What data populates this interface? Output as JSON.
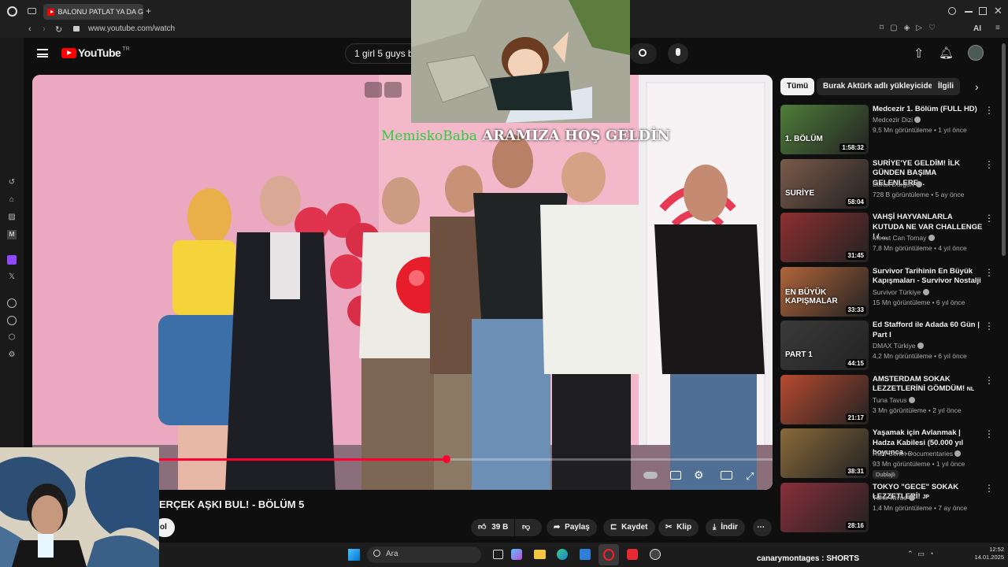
{
  "browser": {
    "tab_title": "BALONU PATLAT YA DA G",
    "address": "www.youtube.com/watch",
    "ai_label": "AI"
  },
  "youtube": {
    "logo": "YouTube",
    "region": "TR",
    "search_value": "1 girl 5 guys bli"
  },
  "overlay": {
    "ticker_name": "MemiskoBaba",
    "ticker_text": "ARAMIZA HOŞ GELDİN",
    "bottom_caption_user": "canarymontages",
    "bottom_caption_sep": ":",
    "bottom_caption_text": "SHORTS"
  },
  "video": {
    "title_visible": "ERÇEK AŞKI BUL! - BÖLÜM 5",
    "progress": 0.56,
    "sub_button_fragment": "ol"
  },
  "actions": {
    "like_count": "39 B",
    "share": "Paylaş",
    "save": "Kaydet",
    "clip": "Klip",
    "download": "İndir"
  },
  "chips": [
    "Tümü",
    "Burak Aktürk adlı yükleyiciden",
    "İlgili"
  ],
  "recommendations": [
    {
      "title": "Medcezir 1. Bölüm (FULL HD)",
      "channel": "Medcezir Dizi",
      "meta": "9,5 Mn görüntüleme • 1 yıl önce",
      "duration": "1:58:32",
      "thumb_text": "1. BÖLÜM",
      "color": "#4f7d3a"
    },
    {
      "title": "SURİYE'YE GELDİM! İLK GÜNDEN BAŞIMA GELENLERE...",
      "channel": "Burak Durgun",
      "meta": "728 B görüntüleme • 5 ay önce",
      "duration": "58:04",
      "thumb_text": "SURİYE",
      "color": "#7a5a4a"
    },
    {
      "title": "VAHŞİ HAYVANLARLA KUTUDA NE VAR CHALLENGE ! / ...",
      "channel": "Mesut Can Tomay",
      "meta": "7,8 Mn görüntüleme • 4 yıl önce",
      "duration": "31:45",
      "thumb_text": "",
      "color": "#8e2f2f"
    },
    {
      "title": "Survivor Tarihinin En Büyük Kapışmaları - Survivor Nostalji",
      "channel": "Survivor Türkiye",
      "meta": "15 Mn görüntüleme • 6 yıl önce",
      "duration": "33:33",
      "thumb_text": "EN BÜYÜK KAPIŞMALAR",
      "color": "#b0643a"
    },
    {
      "title": "Ed Stafford ile Adada 60 Gün | Part I",
      "channel": "DMAX Türkiye",
      "meta": "4,2 Mn görüntüleme • 6 yıl önce",
      "duration": "44:15",
      "thumb_text": "PART 1",
      "color": "#3a3a3a"
    },
    {
      "title": "AMSTERDAM SOKAK LEZZETLERİNİ GÖMDÜM!",
      "title_suffix": "NL",
      "channel": "Tuna Tavus",
      "meta": "3 Mn görüntüleme • 2 yıl önce",
      "duration": "21:17",
      "thumb_text": "",
      "color": "#b74a2f"
    },
    {
      "title": "Yaşamak için Avlanmak | Hadza Kabilesi (50.000 yıl boyunca ...",
      "channel": "Ruhi Cenet Documentaries",
      "meta": "93 Mn görüntüleme • 1 yıl önce",
      "duration": "38:31",
      "badge": "Dublajlı",
      "thumb_text": "",
      "color": "#8a6a3a"
    },
    {
      "title": "TOKYO \"GECE\" SOKAK LEZZETLERİ!",
      "title_suffix": "JP",
      "channel": "Tuna Tavus",
      "meta": "1,4 Mn görüntüleme • 7 ay önce",
      "duration": "28:16",
      "thumb_text": "",
      "color": "#8a2f3a"
    }
  ],
  "taskbar": {
    "search_placeholder": "Ara",
    "time": "12:52",
    "date": "14.01.2025"
  },
  "colors": {
    "youtube_red": "#ff0000",
    "progress_red": "#f03",
    "chip_active_bg": "#f1f1f1",
    "ticker_name_color": "#2ecc40"
  }
}
